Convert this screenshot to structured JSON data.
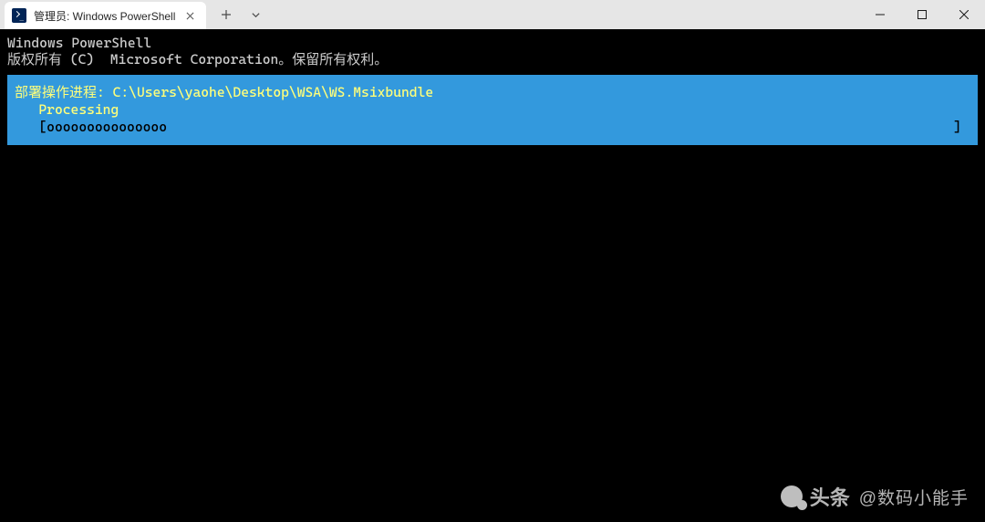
{
  "window": {
    "tab_title": "管理员: Windows PowerShell"
  },
  "terminal": {
    "line1": "Windows PowerShell",
    "line2": "版权所有 (C)  Microsoft Corporation。保留所有权利。"
  },
  "progress": {
    "title": "部署操作进程: C:\\Users\\yaohe\\Desktop\\WSA\\WS.Msixbundle",
    "status": "   Processing",
    "bar_open": "   [",
    "bar_fill": "ooooooooooooooo",
    "bar_close": "]"
  },
  "watermark": {
    "brand": "头条",
    "handle": "@数码小能手"
  }
}
